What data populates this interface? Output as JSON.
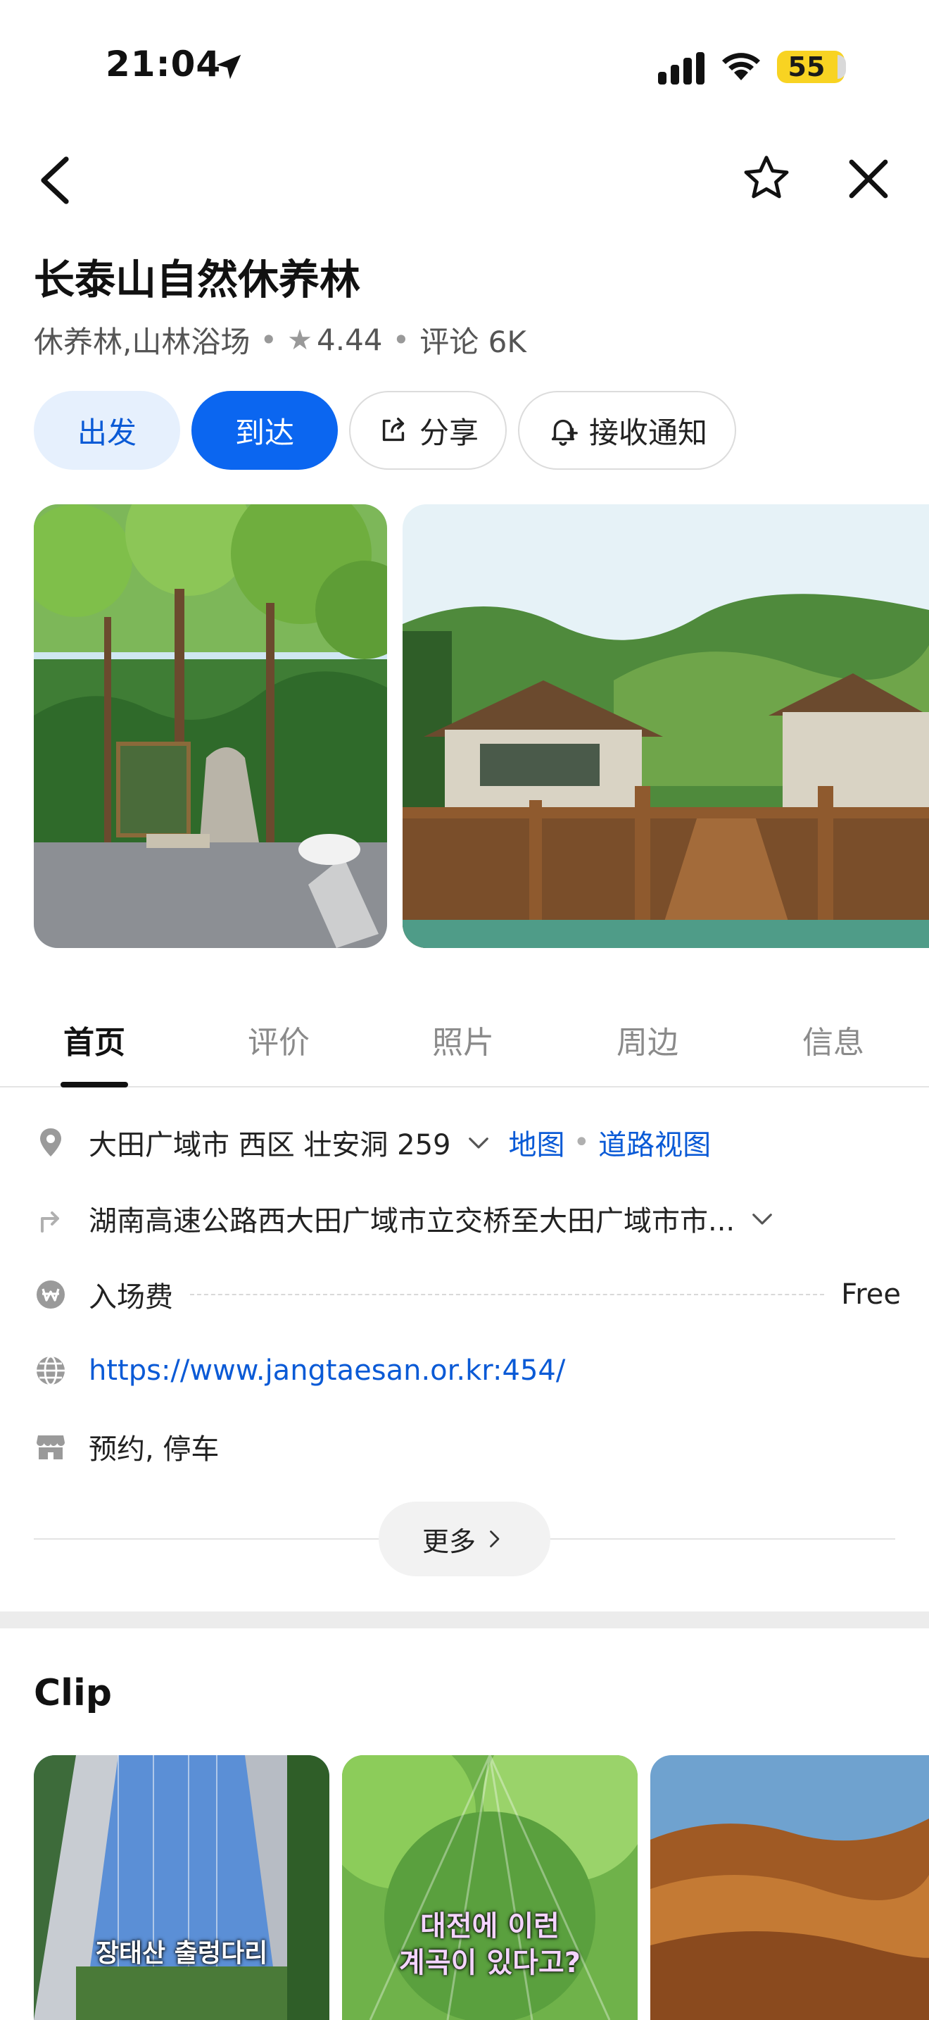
{
  "status_bar": {
    "time": "21:04",
    "battery": "55"
  },
  "place": {
    "title": "长泰山自然休养林",
    "category": "休养林,山林浴场",
    "rating": "4.44",
    "reviews": "评论 6K"
  },
  "actions": {
    "depart": "出发",
    "arrive": "到达",
    "share": "分享",
    "notify": "接收通知"
  },
  "tabs": [
    "首页",
    "评价",
    "照片",
    "周边",
    "信息"
  ],
  "info": {
    "address": "大田广域市 西区 壮安洞 259",
    "map_link": "地图",
    "road_view_link": "道路视图",
    "directions": "湖南高速公路西大田广域市立交桥至大田广域市市...",
    "fee_label": "入场费",
    "fee_value": "Free",
    "website": "https://www.jangtaesan.or.kr:454/",
    "amenities": "预约, 停车"
  },
  "more_label": "更多",
  "clip": {
    "title": "Clip",
    "items": [
      {
        "caption": "장태산 출렁다리"
      },
      {
        "caption_line1": "대전에 이런",
        "caption_line2": "계곡이 있다고?"
      },
      {
        "caption": ""
      }
    ]
  },
  "colors": {
    "accent": "#0b66f0",
    "link": "#0a5ad6",
    "battery": "#f8d322"
  }
}
